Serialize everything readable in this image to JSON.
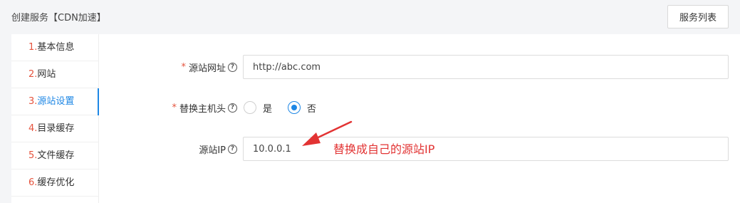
{
  "header": {
    "title": "创建服务【CDN加速】",
    "service_list_label": "服务列表"
  },
  "steps": [
    {
      "num": "1.",
      "label": "基本信息"
    },
    {
      "num": "2.",
      "label": "网站"
    },
    {
      "num": "3.",
      "label": "源站设置"
    },
    {
      "num": "4.",
      "label": "目录缓存"
    },
    {
      "num": "5.",
      "label": "文件缓存"
    },
    {
      "num": "6.",
      "label": "缓存优化"
    }
  ],
  "form": {
    "origin_url": {
      "required_mark": "*",
      "label": "源站网址",
      "value": "http://abc.com"
    },
    "replace_host": {
      "required_mark": "*",
      "label": "替换主机头",
      "options": [
        "是",
        "否"
      ],
      "selected": "否"
    },
    "origin_ip": {
      "label": "源站IP",
      "value": "10.0.0.1"
    },
    "help_glyph": "?"
  },
  "annotation": {
    "text": "替换成自己的源站IP",
    "color": "#e23333"
  },
  "colors": {
    "accent": "#1e87e5",
    "step_number": "#e5533d"
  }
}
